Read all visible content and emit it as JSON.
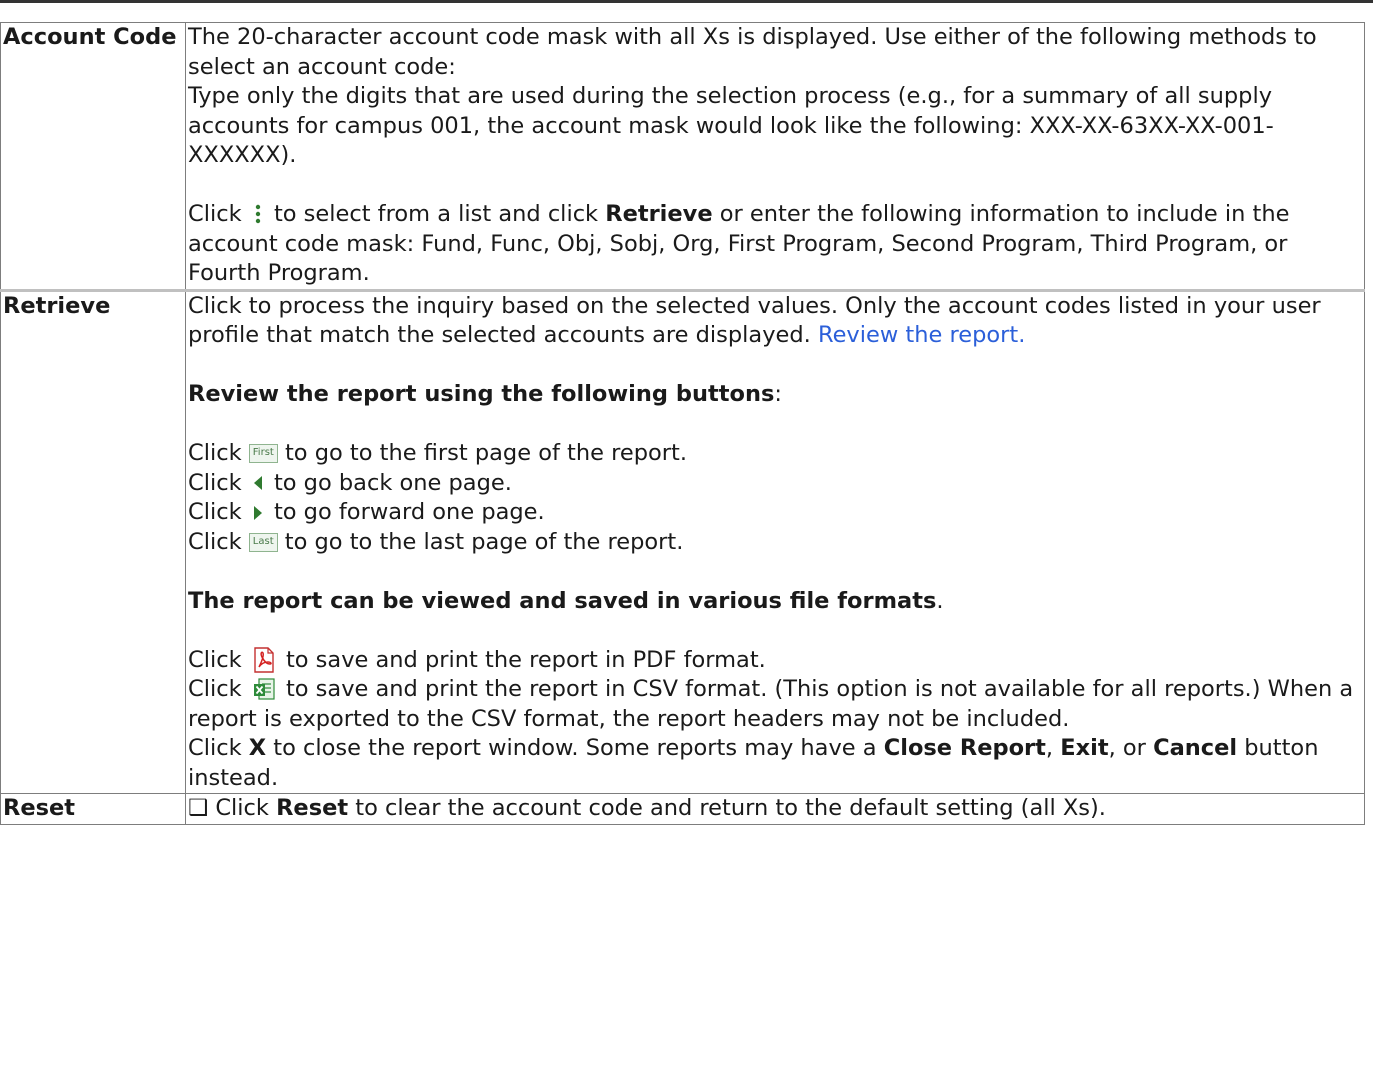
{
  "account_code": {
    "term": "Account Code",
    "p1": "The 20-character account code mask with all Xs is displayed. Use either of the following methods to select an account code:",
    "p2": "Type only the digits that are used during the selection process (e.g., for a summary of all supply accounts for campus 001, the account mask would look like the following: XXX-XX-63XX-XX-001-XXXXXX).",
    "p3_a": "Click",
    "p3_b": "to select from a list and click",
    "p3_bold": "Retrieve",
    "p3_c": "or enter the following information to include in the account code mask: Fund, Func, Obj, Sobj, Org, First Program, Second Program, Third Program, or Fourth Program."
  },
  "retrieve": {
    "term": "Retrieve",
    "intro": "Click to process the inquiry based on the selected values. Only the account codes listed in your user profile that match the selected accounts are displayed.",
    "link": "Review the report.",
    "buttons_heading": "Review the report using the following buttons",
    "buttons_heading_tail": ":",
    "nav": [
      {
        "pre": "Click",
        "icon": "first-page-icon",
        "label": "First",
        "post": "to go to the first page of the report."
      },
      {
        "pre": "Click",
        "icon": "previous-page-icon",
        "post": "to go back one page."
      },
      {
        "pre": "Click",
        "icon": "next-page-icon",
        "post": "to go forward one page."
      },
      {
        "pre": "Click",
        "icon": "last-page-icon",
        "label": "Last",
        "post": "to go to the last page of the report."
      }
    ],
    "formats_heading": "The report can be viewed and saved in various file formats",
    "formats_heading_tail": ".",
    "pdf_pre": "Click",
    "pdf_post": "to save and print the report in PDF format.",
    "csv_pre": "Click",
    "csv_post": "to save and print the report in CSV format. (This option is not available for all reports.) When a report is exported to the CSV format, the report headers may not be included.",
    "close_a": "Click",
    "close_x": "X",
    "close_b": "to close the report window. Some reports may have a",
    "close_report": "Close Report",
    "comma1": ",",
    "exit": "Exit",
    "close_c": ", or",
    "cancel": "Cancel",
    "close_d": "button instead."
  },
  "reset": {
    "term": "Reset",
    "checkbox": "❑",
    "a": "Click",
    "bold": "Reset",
    "b": "to clear the account code and return to the default setting (all Xs)."
  },
  "colors": {
    "link": "#2b5fd9",
    "pdf_red": "#d42020",
    "csv_green": "#2e8b3a",
    "arrow_green": "#2f7a2f"
  }
}
